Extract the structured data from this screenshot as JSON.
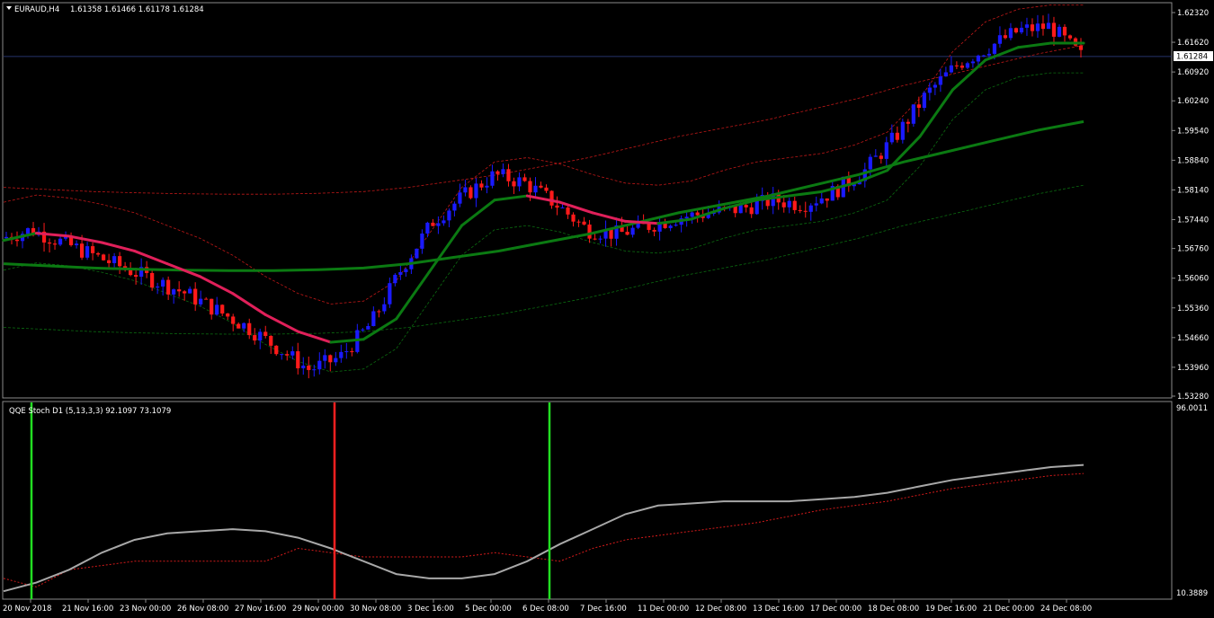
{
  "main_chart": {
    "symbol_label": "EURAUD,H4",
    "ohlc_label": "1.61358 1.61466 1.61178 1.61284",
    "current_price_label": "1.61284",
    "current_price": 1.61284,
    "price_axis_ticks": [
      "1.62320",
      "1.61620",
      "1.60920",
      "1.60240",
      "1.59540",
      "1.58840",
      "1.58140",
      "1.57440",
      "1.56760",
      "1.56060",
      "1.55360",
      "1.54660",
      "1.53960",
      "1.53280"
    ],
    "colors": {
      "bull": "#1a1aff",
      "bear": "#ff1a1a",
      "ma_green": "#0b7a12",
      "ma_red": "#e0205a",
      "band_red": "#c01818",
      "band_green": "#0b6b10",
      "price_line": "#25336b"
    }
  },
  "indicator": {
    "label": "QQE Stoch D1 (5,13,3,3) 92.1097 73.1079",
    "axis_top_label": "96.0011",
    "axis_bottom_label": "10.3889",
    "signal_lines": [
      {
        "color": "#22dd22",
        "x_label": "20 Nov 2018"
      },
      {
        "color": "#ff2020",
        "x_label": "29 Nov 00:00"
      },
      {
        "color": "#22dd22",
        "x_label": "6 Dec 08:00"
      }
    ]
  },
  "time_axis": [
    "20 Nov 2018",
    "21 Nov 16:00",
    "23 Nov 00:00",
    "26 Nov 08:00",
    "27 Nov 16:00",
    "29 Nov 00:00",
    "30 Nov 08:00",
    "3 Dec 16:00",
    "5 Dec 00:00",
    "6 Dec 08:00",
    "7 Dec 16:00",
    "11 Dec 00:00",
    "12 Dec 08:00",
    "13 Dec 16:00",
    "17 Dec 00:00",
    "18 Dec 08:00",
    "19 Dec 16:00",
    "21 Dec 00:00",
    "24 Dec 08:00"
  ],
  "chart_data": [
    {
      "type": "candlestick",
      "title": "EURAUD,H4",
      "ylim": [
        1.5328,
        1.6248
      ],
      "x": [
        "20 Nov 2018",
        "21 Nov 16:00",
        "23 Nov 00:00",
        "26 Nov 08:00",
        "27 Nov 16:00",
        "29 Nov 00:00",
        "30 Nov 08:00",
        "3 Dec 16:00",
        "5 Dec 00:00",
        "6 Dec 08:00",
        "7 Dec 16:00",
        "11 Dec 00:00",
        "12 Dec 08:00",
        "13 Dec 16:00",
        "17 Dec 00:00",
        "18 Dec 08:00",
        "19 Dec 16:00",
        "21 Dec 00:00",
        "24 Dec 08:00"
      ],
      "close_path": [
        1.57,
        1.572,
        1.569,
        1.566,
        1.563,
        1.56,
        1.557,
        1.553,
        1.549,
        1.544,
        1.539,
        1.542,
        1.55,
        1.563,
        1.574,
        1.58,
        1.585,
        1.583,
        1.578,
        1.572,
        1.571,
        1.573,
        1.575,
        1.576,
        1.577,
        1.579,
        1.578,
        1.581,
        1.586,
        1.594,
        1.604,
        1.611,
        1.615,
        1.619,
        1.62,
        1.613
      ],
      "series": [
        {
          "name": "MA",
          "values": [
            1.5695,
            1.5712,
            1.5705,
            1.569,
            1.567,
            1.564,
            1.561,
            1.557,
            1.552,
            1.548,
            1.5455,
            1.5462,
            1.551,
            1.562,
            1.573,
            1.579,
            1.58,
            1.5785,
            1.576,
            1.574,
            1.5735,
            1.5745,
            1.577,
            1.579,
            1.58,
            1.581,
            1.583,
            1.586,
            1.594,
            1.605,
            1.612,
            1.615,
            1.616,
            1.616
          ]
        },
        {
          "name": "MA2",
          "values": [
            1.564,
            1.5635,
            1.563,
            1.5627,
            1.5625,
            1.5624,
            1.5624,
            1.5626,
            1.563,
            1.564,
            1.5655,
            1.567,
            1.569,
            1.571,
            1.5735,
            1.576,
            1.578,
            1.58,
            1.5825,
            1.585,
            1.588,
            1.5905,
            1.593,
            1.5955,
            1.5975
          ]
        }
      ]
    },
    {
      "type": "line",
      "title": "QQE Stoch D1 (5,13,3,3)",
      "ylim": [
        10.3889,
        96.0011
      ],
      "series": [
        {
          "name": "QQE",
          "values": [
            12,
            16,
            22,
            30,
            36,
            39,
            40,
            41,
            40,
            37,
            32,
            26,
            20,
            18,
            18,
            20,
            26,
            34,
            41,
            48,
            52,
            53,
            54,
            54,
            54,
            55,
            56,
            58,
            61,
            64,
            66,
            68,
            70,
            71
          ]
        },
        {
          "name": "Signal",
          "values": [
            18,
            14,
            22,
            24,
            26,
            26,
            26,
            26,
            26,
            32,
            30,
            28,
            28,
            28,
            28,
            30,
            28,
            26,
            32,
            36,
            38,
            40,
            42,
            44,
            47,
            50,
            52,
            54,
            57,
            60,
            62,
            64,
            66,
            67
          ]
        }
      ]
    }
  ]
}
